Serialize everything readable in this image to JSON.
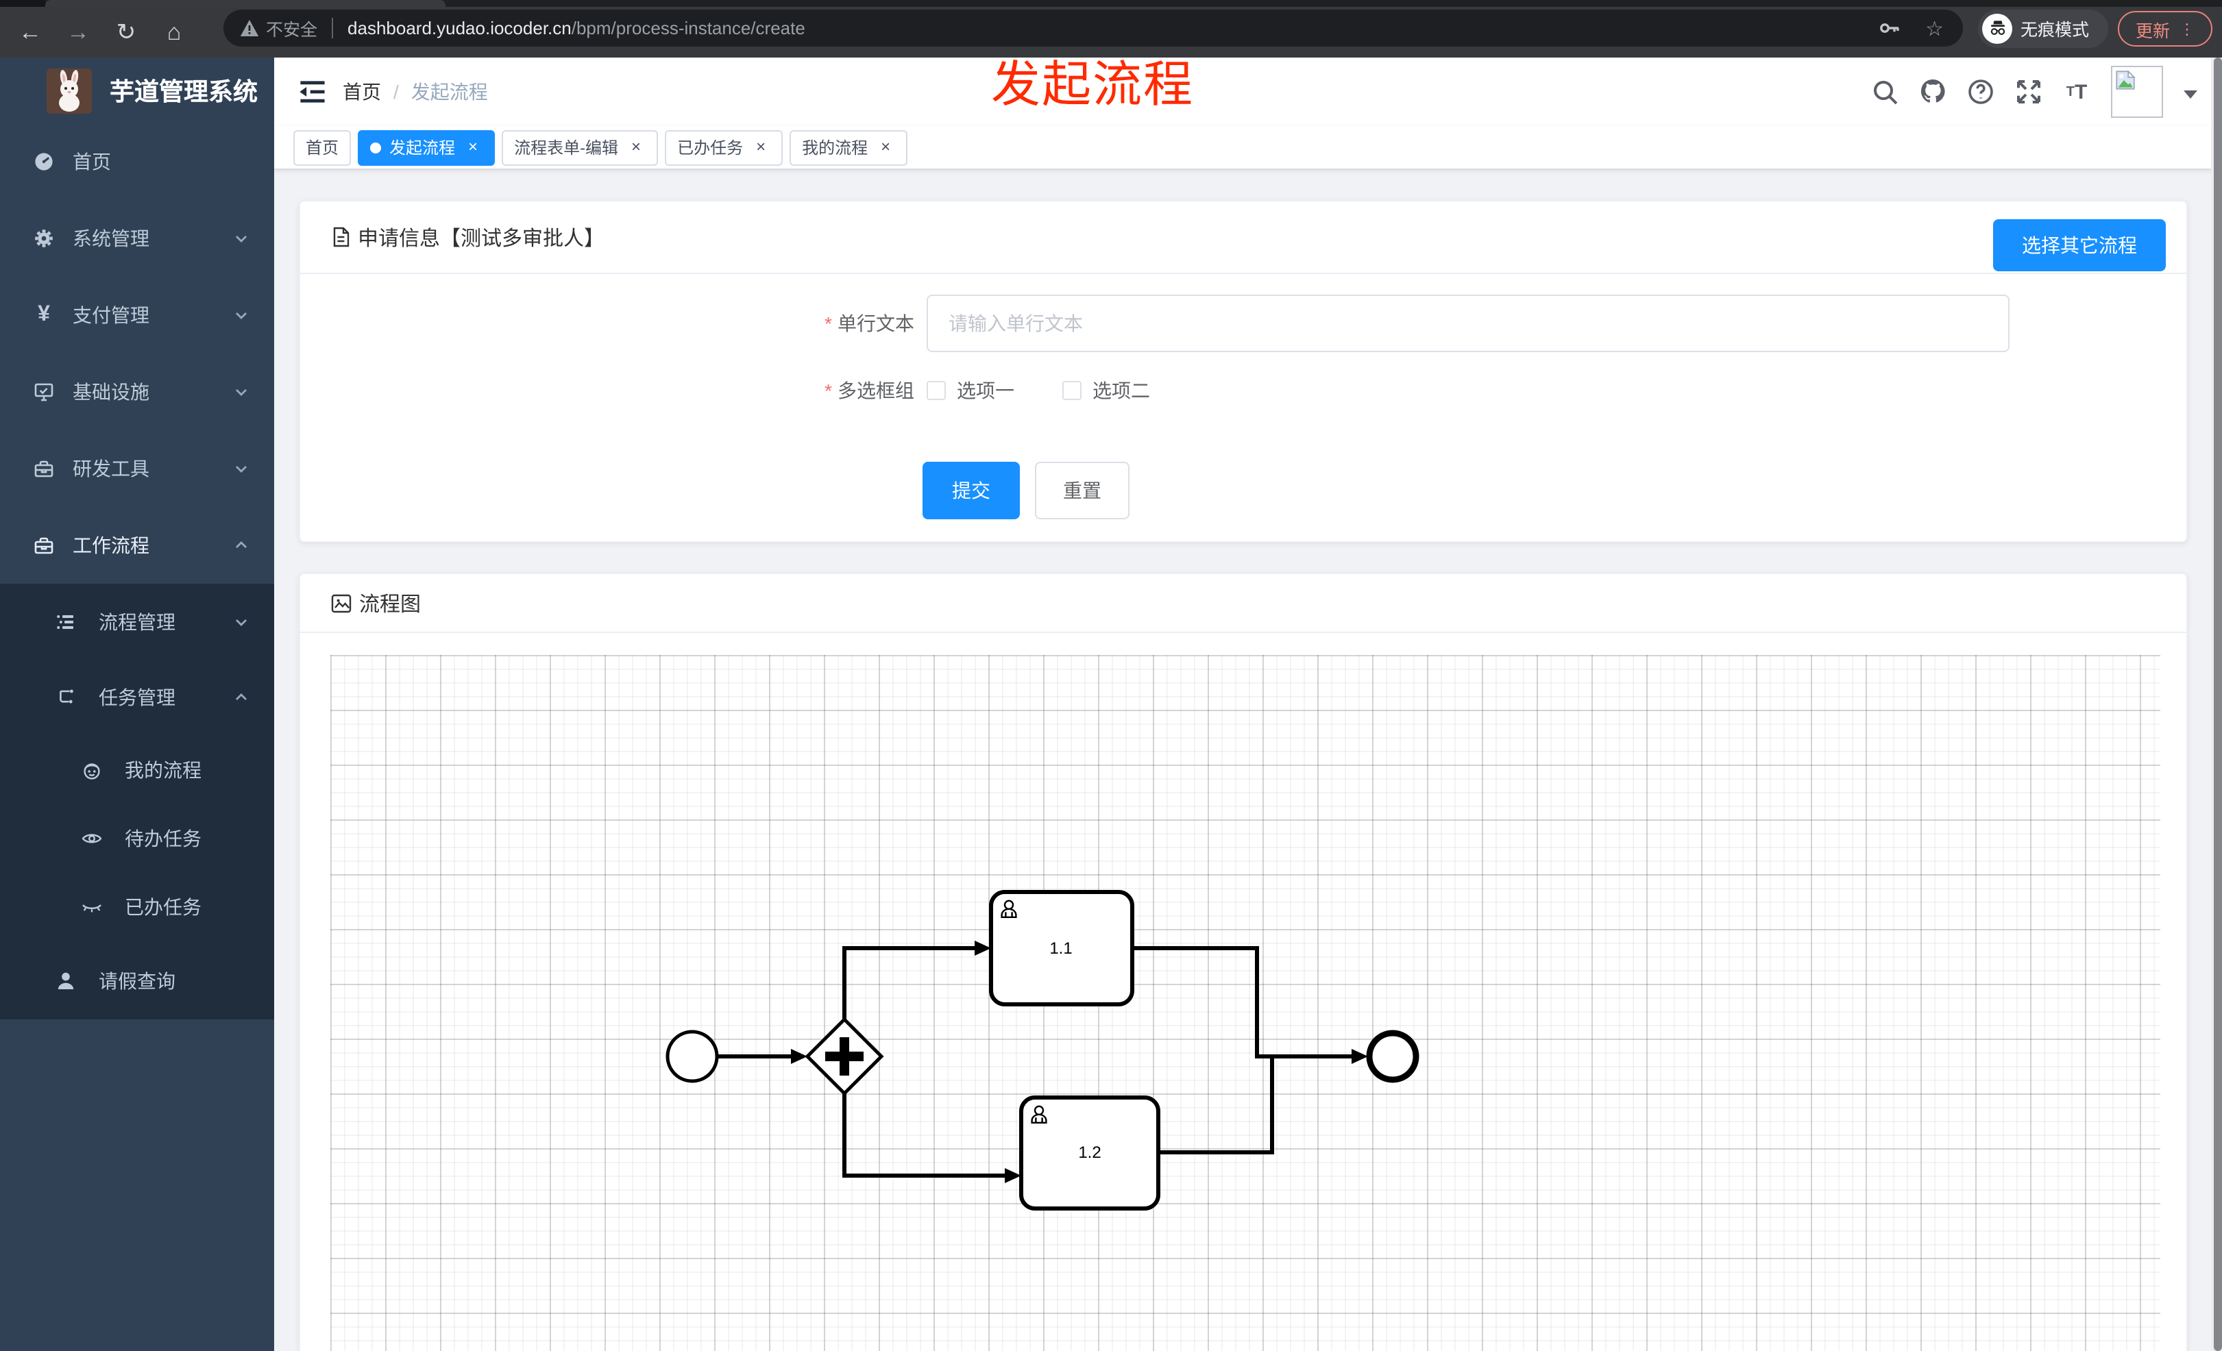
{
  "browser": {
    "security_label": "不安全",
    "url_host": "dashboard.yudao.iocoder.cn",
    "url_path": "/bpm/process-instance/create",
    "incognito_label": "无痕模式",
    "update_label": "更新"
  },
  "annotation": {
    "text": "发起流程"
  },
  "sidebar": {
    "title": "芋道管理系统",
    "items": [
      {
        "label": "首页"
      },
      {
        "label": "系统管理"
      },
      {
        "label": "支付管理"
      },
      {
        "label": "基础设施"
      },
      {
        "label": "研发工具"
      },
      {
        "label": "工作流程"
      },
      {
        "label": "流程管理"
      },
      {
        "label": "任务管理"
      },
      {
        "label": "我的流程"
      },
      {
        "label": "待办任务"
      },
      {
        "label": "已办任务"
      },
      {
        "label": "请假查询"
      }
    ]
  },
  "header": {
    "breadcrumb": [
      "首页",
      "发起流程"
    ]
  },
  "tabs": [
    {
      "label": "首页"
    },
    {
      "label": "发起流程"
    },
    {
      "label": "流程表单-编辑"
    },
    {
      "label": "已办任务"
    },
    {
      "label": "我的流程"
    }
  ],
  "form": {
    "title": "申请信息【测试多审批人】",
    "choose_button": "选择其它流程",
    "single_line": {
      "label": "单行文本",
      "placeholder": "请输入单行文本"
    },
    "checkbox_group": {
      "label": "多选框组",
      "options": [
        "选项一",
        "选项二"
      ]
    },
    "submit": "提交",
    "reset": "重置"
  },
  "diagram": {
    "title": "流程图",
    "task_labels": [
      "1.1",
      "1.2"
    ]
  },
  "colors": {
    "primary": "#1890ff",
    "annotation_red": "#ff2a00",
    "sidebar_bg": "#304156",
    "submenu_bg": "#1f2d3d",
    "page_bg": "#f0f2f5"
  }
}
